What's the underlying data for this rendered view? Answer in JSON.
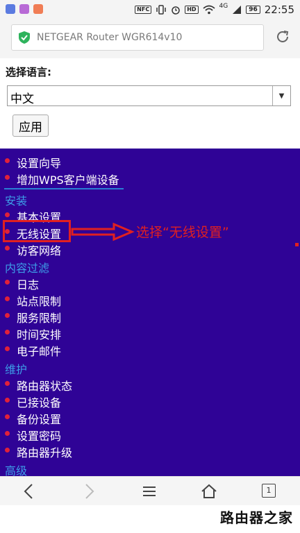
{
  "status_bar": {
    "network_type": "4G",
    "nfc_label": "NFC",
    "hd_label": "HD",
    "battery": "96",
    "time": "22:55"
  },
  "address_bar": {
    "title": "NETGEAR Router WGR614v10"
  },
  "language": {
    "label": "选择语言:",
    "selected": "中文",
    "apply_label": "应用"
  },
  "menu": {
    "top_items": [
      "设置向导",
      "增加WPS客户端设备"
    ],
    "sections": [
      {
        "title": "安装",
        "items": [
          "基本设置",
          "无线设置",
          "访客网络"
        ]
      },
      {
        "title": "内容过滤",
        "items": [
          "日志",
          "站点限制",
          "服务限制",
          "时间安排",
          "电子邮件"
        ]
      },
      {
        "title": "维护",
        "items": [
          "路由器状态",
          "已接设备",
          "备份设置",
          "设置密码",
          "路由器升级"
        ]
      },
      {
        "title": "高级",
        "items": []
      }
    ],
    "annotation": "选择“无线设置”",
    "highlighted_item": "无线设置"
  },
  "bottom_bar": {
    "tab_count": "1"
  },
  "watermark": "路由器之家",
  "colors": {
    "menu_background": "#2f0396",
    "section_heading": "#3d9de8",
    "bullet": "#e0213a",
    "annotation": "#e12020",
    "secure_shield": "#2eb35c"
  }
}
